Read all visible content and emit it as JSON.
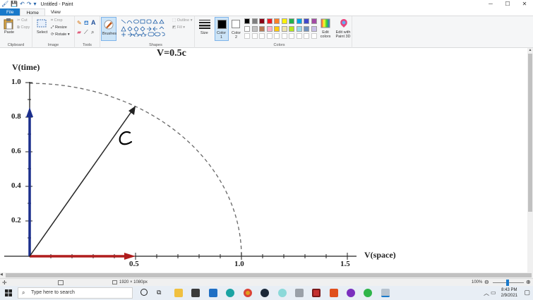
{
  "window": {
    "title": "Untitled - Paint"
  },
  "tabs": [
    {
      "label": "File"
    },
    {
      "label": "Home"
    },
    {
      "label": "View"
    }
  ],
  "ribbon": {
    "clipboard": {
      "label": "Clipboard",
      "paste": "Paste",
      "cut": "Cut",
      "copy": "Copy"
    },
    "image": {
      "label": "Image",
      "select": "Select",
      "crop": "Crop",
      "resize": "Resize",
      "rotate": "Rotate"
    },
    "tools": {
      "label": "Tools"
    },
    "brushes": {
      "label": "Brushes"
    },
    "shapes": {
      "label": "Shapes",
      "outline": "Outline",
      "fill": "Fill"
    },
    "size": {
      "label": "Size"
    },
    "color1": {
      "label": "Color\n1"
    },
    "color2": {
      "label": "Color\n2"
    },
    "colors": {
      "label": "Colors",
      "edit_colors": "Edit colors",
      "edit_paint3d": "Edit with Paint 3D"
    },
    "palette": [
      "#000000",
      "#7f7f7f",
      "#880015",
      "#ed1c24",
      "#ff7f27",
      "#fff200",
      "#22b14c",
      "#00a2e8",
      "#3f48cc",
      "#a349a4",
      "#ffffff",
      "#c3c3c3",
      "#b97a57",
      "#ffaec9",
      "#ffc90e",
      "#efe4b0",
      "#b5e61d",
      "#99d9ea",
      "#7092be",
      "#c8bfe7"
    ]
  },
  "drawing": {
    "title": "V=0.5c",
    "y_axis_label": "V(time)",
    "x_axis_label": "V(space)",
    "y_ticks": [
      "1.0",
      "0.8",
      "0.6",
      "0.4",
      "0.2"
    ],
    "x_ticks": [
      "0.5",
      "1.0",
      "1.5"
    ],
    "handwritten": "c"
  },
  "status": {
    "dimensions": "1920 × 1080px",
    "zoom": "100%"
  },
  "taskbar": {
    "search_placeholder": "Type here to search",
    "time": "8:43 PM",
    "date": "2/9/2021"
  }
}
